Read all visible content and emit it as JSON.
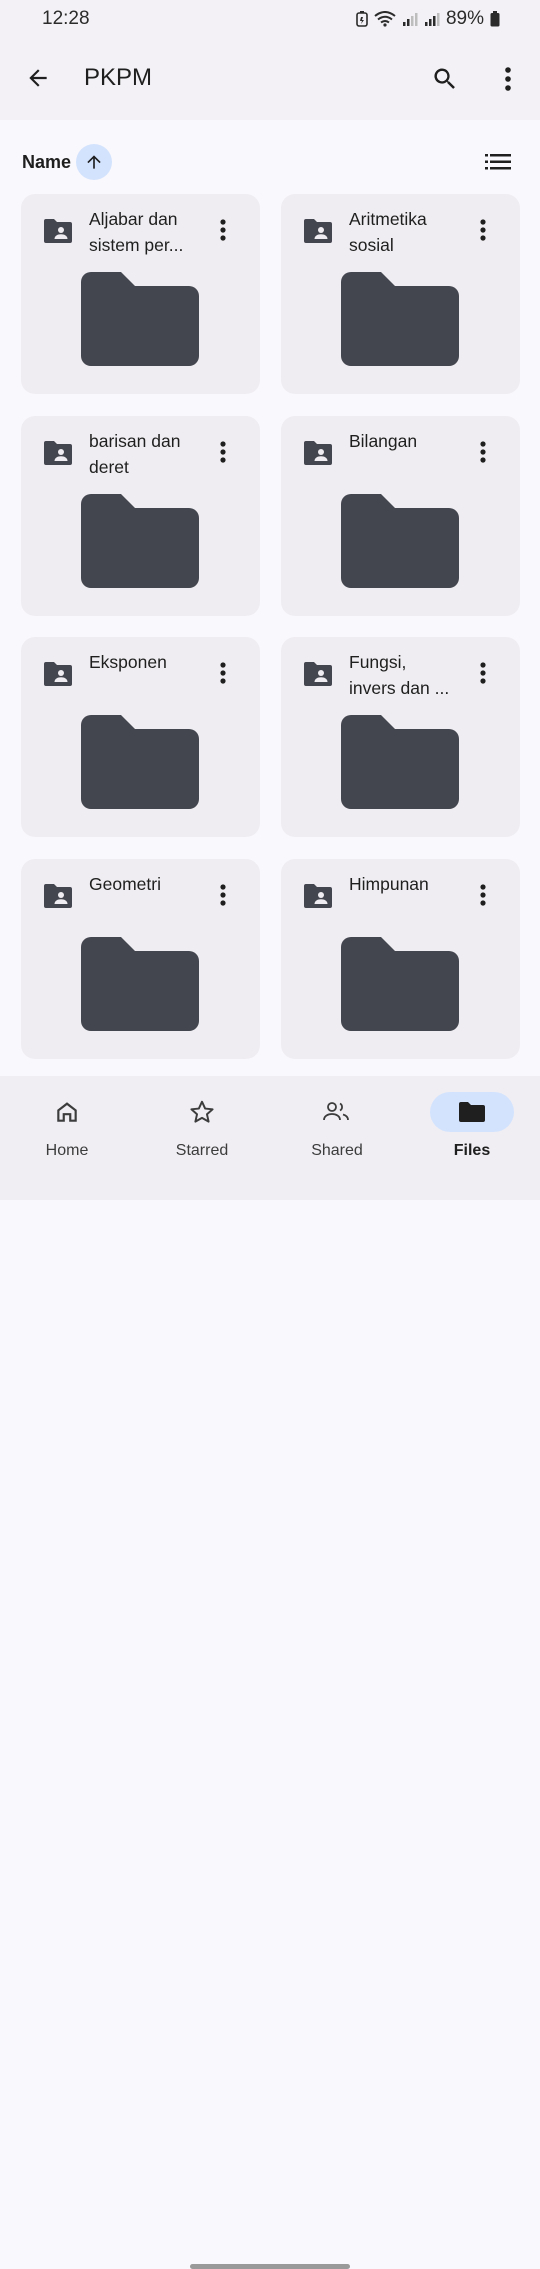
{
  "status_bar": {
    "time": "12:28",
    "battery": "89%"
  },
  "top_bar": {
    "title": "PKPM"
  },
  "sort": {
    "label": "Name"
  },
  "folders": [
    {
      "name": "Aljabar dan\nsistem per..."
    },
    {
      "name": "Aritmetika\nsosial"
    },
    {
      "name": "barisan dan\nderet"
    },
    {
      "name": "Bilangan"
    },
    {
      "name": "Eksponen"
    },
    {
      "name": "Fungsi,\ninvers dan ..."
    },
    {
      "name": "Geometri"
    },
    {
      "name": "Himpunan"
    }
  ],
  "nav": [
    {
      "label": "Home",
      "icon": "home-icon"
    },
    {
      "label": "Starred",
      "icon": "star-icon"
    },
    {
      "label": "Shared",
      "icon": "people-icon"
    },
    {
      "label": "Files",
      "icon": "folder-icon",
      "active": true
    }
  ],
  "colors": {
    "folder": "#44464f",
    "active_pill": "#d3e3fd",
    "card": "#efedf1"
  }
}
